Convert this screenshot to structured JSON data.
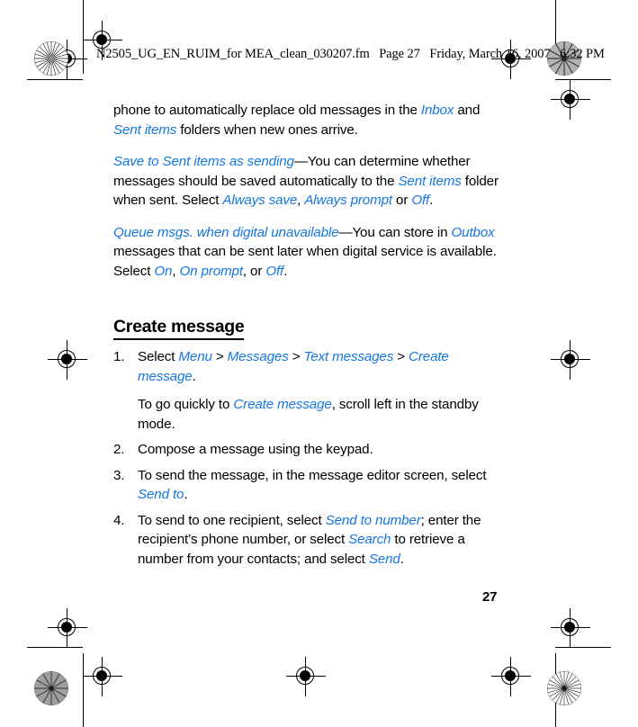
{
  "document": {
    "slug_line": {
      "filename": "N2505_UG_EN_RUIM_for MEA_clean_030207.fm",
      "page_label": "Page 27",
      "date": "Friday, March 16, 2007",
      "time": "6:32 PM"
    },
    "page_number": "27",
    "accent_color": "#1577e0"
  },
  "body": {
    "paragraphs": [
      {
        "runs": [
          {
            "text": "phone to automatically replace old messages in the ",
            "style": "normal"
          },
          {
            "text": "Inbox",
            "style": "link"
          },
          {
            "text": " and ",
            "style": "normal"
          },
          {
            "text": "Sent items",
            "style": "link"
          },
          {
            "text": " folders when new ones arrive.",
            "style": "normal"
          }
        ]
      },
      {
        "runs": [
          {
            "text": "Save to Sent items as sending",
            "style": "link"
          },
          {
            "text": "—You can determine whether messages should be saved automatically to the ",
            "style": "normal"
          },
          {
            "text": "Sent items",
            "style": "link"
          },
          {
            "text": " folder when sent. Select ",
            "style": "normal"
          },
          {
            "text": "Always save",
            "style": "link"
          },
          {
            "text": ", ",
            "style": "normal"
          },
          {
            "text": "Always prompt",
            "style": "link"
          },
          {
            "text": " or ",
            "style": "normal"
          },
          {
            "text": "Off",
            "style": "link"
          },
          {
            "text": ".",
            "style": "normal"
          }
        ]
      },
      {
        "runs": [
          {
            "text": "Queue msgs. when digital unavailable",
            "style": "link"
          },
          {
            "text": "—You can store in ",
            "style": "normal"
          },
          {
            "text": "Outbox",
            "style": "link"
          },
          {
            "text": " messages that can be sent later when digital service is available. Select ",
            "style": "normal"
          },
          {
            "text": "On",
            "style": "link"
          },
          {
            "text": ", ",
            "style": "normal"
          },
          {
            "text": "On prompt",
            "style": "link"
          },
          {
            "text": ", or ",
            "style": "normal"
          },
          {
            "text": "Off",
            "style": "link"
          },
          {
            "text": ".",
            "style": "normal"
          }
        ]
      }
    ],
    "section": {
      "heading": "Create message",
      "steps": [
        {
          "number": "1.",
          "runs": [
            {
              "text": "Select ",
              "style": "normal"
            },
            {
              "text": "Menu",
              "style": "link"
            },
            {
              "text": " > ",
              "style": "normal"
            },
            {
              "text": "Messages",
              "style": "link"
            },
            {
              "text": " > ",
              "style": "normal"
            },
            {
              "text": "Text messages",
              "style": "link"
            },
            {
              "text": " > ",
              "style": "normal"
            },
            {
              "text": "Create message",
              "style": "link"
            },
            {
              "text": ".",
              "style": "normal"
            }
          ],
          "note": {
            "runs": [
              {
                "text": "To go quickly to ",
                "style": "normal"
              },
              {
                "text": "Create message",
                "style": "link"
              },
              {
                "text": ", scroll left in the standby mode.",
                "style": "normal"
              }
            ]
          }
        },
        {
          "number": "2.",
          "runs": [
            {
              "text": "Compose a message using the keypad.",
              "style": "normal"
            }
          ]
        },
        {
          "number": "3.",
          "runs": [
            {
              "text": "To send the message, in the message editor screen, select ",
              "style": "normal"
            },
            {
              "text": "Send to",
              "style": "link"
            },
            {
              "text": ".",
              "style": "normal"
            }
          ]
        },
        {
          "number": "4.",
          "runs": [
            {
              "text": "To send to one recipient, select ",
              "style": "normal"
            },
            {
              "text": "Send to number",
              "style": "link"
            },
            {
              "text": "; enter the recipient’s phone number, or select ",
              "style": "normal"
            },
            {
              "text": "Search",
              "style": "link"
            },
            {
              "text": " to retrieve a number from your contacts; and select ",
              "style": "normal"
            },
            {
              "text": "Send",
              "style": "link"
            },
            {
              "text": ".",
              "style": "normal"
            }
          ]
        }
      ]
    }
  }
}
